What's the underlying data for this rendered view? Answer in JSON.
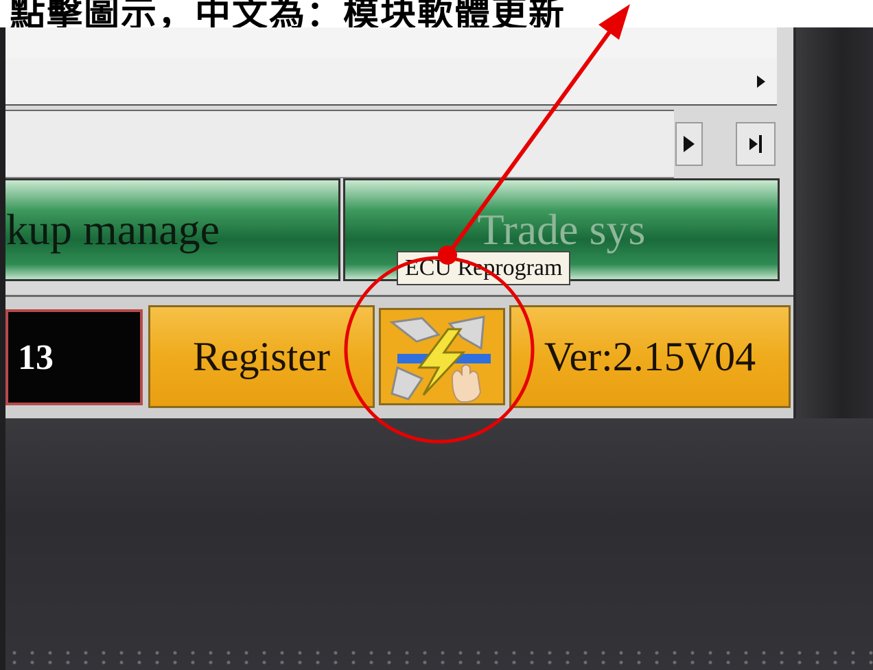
{
  "caption": {
    "text": "點擊圖示，中文為：模块軟體更新"
  },
  "screen": {
    "backup_button_label": "kup manage",
    "trade_button_label": "Trade sys",
    "tooltip_label": "ECU Reprogram",
    "counter_value": "13",
    "register_label": "Register",
    "version_label": "Ver:2.15V04"
  },
  "icons": {
    "scroll_right": "triangle-right",
    "scroll_end": "triangle-right-bar",
    "ecu_reprogram": "lightning-arrows-hand"
  },
  "colors": {
    "green_button": "#1a6b3a",
    "orange_button": "#efab1c",
    "annotation_red": "#e60000",
    "counter_bg": "#050505"
  }
}
